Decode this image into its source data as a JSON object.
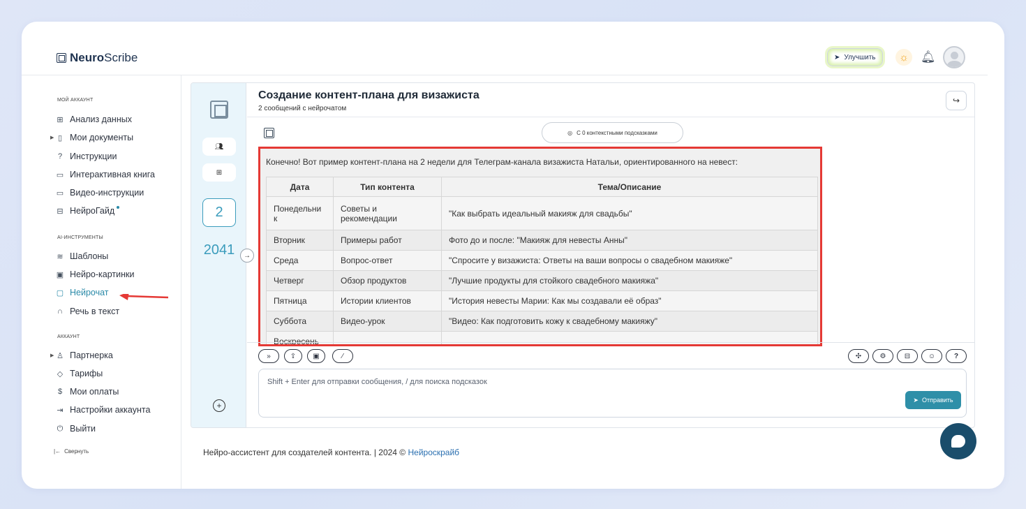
{
  "app": {
    "logo_bold": "Neuro",
    "logo_light": "Scribe"
  },
  "header": {
    "upgrade_label": "Улучшить"
  },
  "sidebar": {
    "section_account": "МОЙ АККАУНТ",
    "items_account": [
      "Анализ данных",
      "Мои документы",
      "Инструкции",
      "Интерактивная книга",
      "Видео-инструкции",
      "НейроГайд"
    ],
    "section_ai": "AI-ИНСТРУМЕНТЫ",
    "items_ai": [
      "Шаблоны",
      "Нейро-картинки",
      "Нейрочат",
      "Речь в текст"
    ],
    "section_profile": "АККАУНТ",
    "items_profile": [
      "Партнерка",
      "Тарифы",
      "Мои оплаты",
      "Настройки аккаунта",
      "Выйти"
    ],
    "collapse_label": "Свернуть"
  },
  "rail": {
    "count": "2",
    "year": "2041"
  },
  "chat": {
    "title": "Создание контент-плана для визажиста",
    "subtitle": "2 сообщений с нейрочатом",
    "hints_label": "С 0 контекстными подсказками",
    "message_intro": "Конечно! Вот пример контент-плана на 2 недели для Телеграм-канала визажиста Натальи, ориентированного на невест:",
    "table": {
      "headers": [
        "Дата",
        "Тип контента",
        "Тема/Описание"
      ],
      "rows": [
        [
          "Понедельни к",
          "Советы и рекомендации",
          "\"Как выбрать идеальный макияж для свадьбы\""
        ],
        [
          "Вторник",
          "Примеры работ",
          "Фото до и после: \"Макияж для невесты Анны\""
        ],
        [
          "Среда",
          "Вопрос-ответ",
          "\"Спросите у визажиста: Ответы на ваши вопросы о свадебном макияже\""
        ],
        [
          "Четверг",
          "Обзор продуктов",
          "\"Лучшие продукты для стойкого свадебного макияжа\""
        ],
        [
          "Пятница",
          "Истории клиентов",
          "\"История невесты Марии: Как мы создавали её образ\""
        ],
        [
          "Суббота",
          "Видео-урок",
          "\"Видео: Как подготовить кожу к свадебному макияжу\""
        ],
        [
          "Воскресень",
          "",
          ""
        ]
      ]
    },
    "input_placeholder": "Shift + Enter для отправки сообщения, / для поиска подсказок",
    "send_label": "Отправить"
  },
  "footer": {
    "text": "Нейро-ассистент для создателей контента.  | 2024 © ",
    "link": "Нейроскрайб"
  },
  "colors": {
    "accent": "#2e8fa8",
    "highlight_border": "#e53935"
  }
}
